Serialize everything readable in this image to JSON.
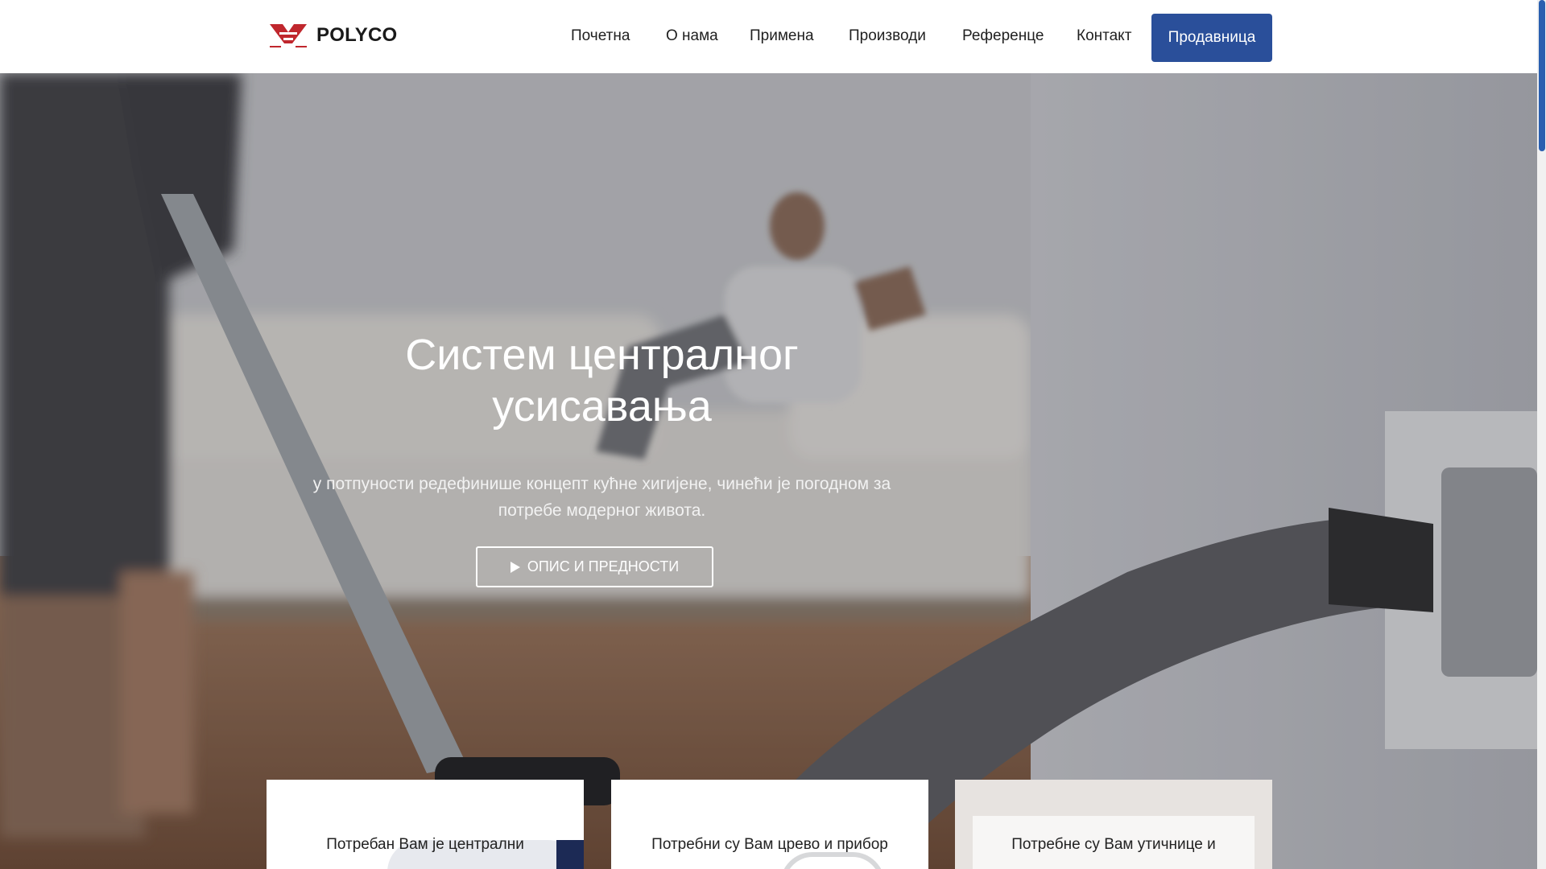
{
  "brand": {
    "name": "POLYCO",
    "accent": "#c0272d",
    "primary": "#2a4f9a"
  },
  "nav": {
    "items": [
      {
        "label": "Почетна"
      },
      {
        "label": "О нама"
      },
      {
        "label": "Примена"
      },
      {
        "label": "Производи"
      },
      {
        "label": "Референце"
      },
      {
        "label": "Контакт"
      }
    ],
    "shop_label": "Продавница"
  },
  "hero": {
    "title_line1": "Систем централног",
    "title_line2": "усисавања",
    "subtitle_line1": "у потпуности редефинише концепт кућне хигијене, чинећи је погодном за",
    "subtitle_line2": "потребе модерног живота.",
    "button_label": "ОПИС И ПРЕДНОСТИ",
    "button_icon": "play-icon"
  },
  "cards": [
    {
      "text": "Потребан Вам је централни"
    },
    {
      "text": "Потребни су Вам црево и прибор"
    },
    {
      "text": "Потребне су Вам утичнице и"
    }
  ]
}
